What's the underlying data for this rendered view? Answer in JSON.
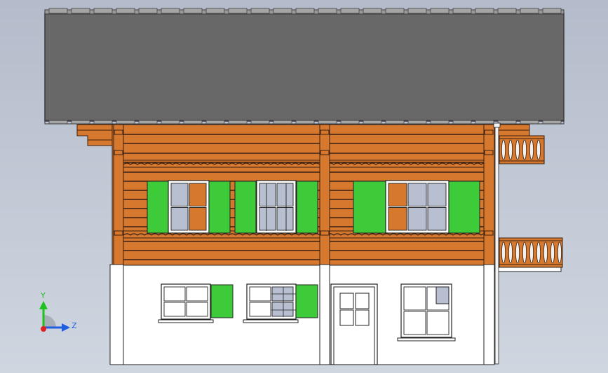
{
  "viewport": {
    "background_top": "#b4bccb",
    "background_bottom": "#cfd6e0"
  },
  "colors": {
    "roof": "#686868",
    "roof_edge": "#3a3a3a",
    "wood": "#d6782e",
    "wood_line": "#3a2010",
    "wall": "#ffffff",
    "outline": "#222222",
    "shutter": "#3ecb3a",
    "glass": "#b8bfd0"
  },
  "triad": {
    "y_label": "Y",
    "z_label": "Z",
    "y_color": "#20c020",
    "z_color": "#1f5ee0",
    "x_color": "#e02020"
  },
  "icons": [
    "coordinate-triad-icon"
  ]
}
